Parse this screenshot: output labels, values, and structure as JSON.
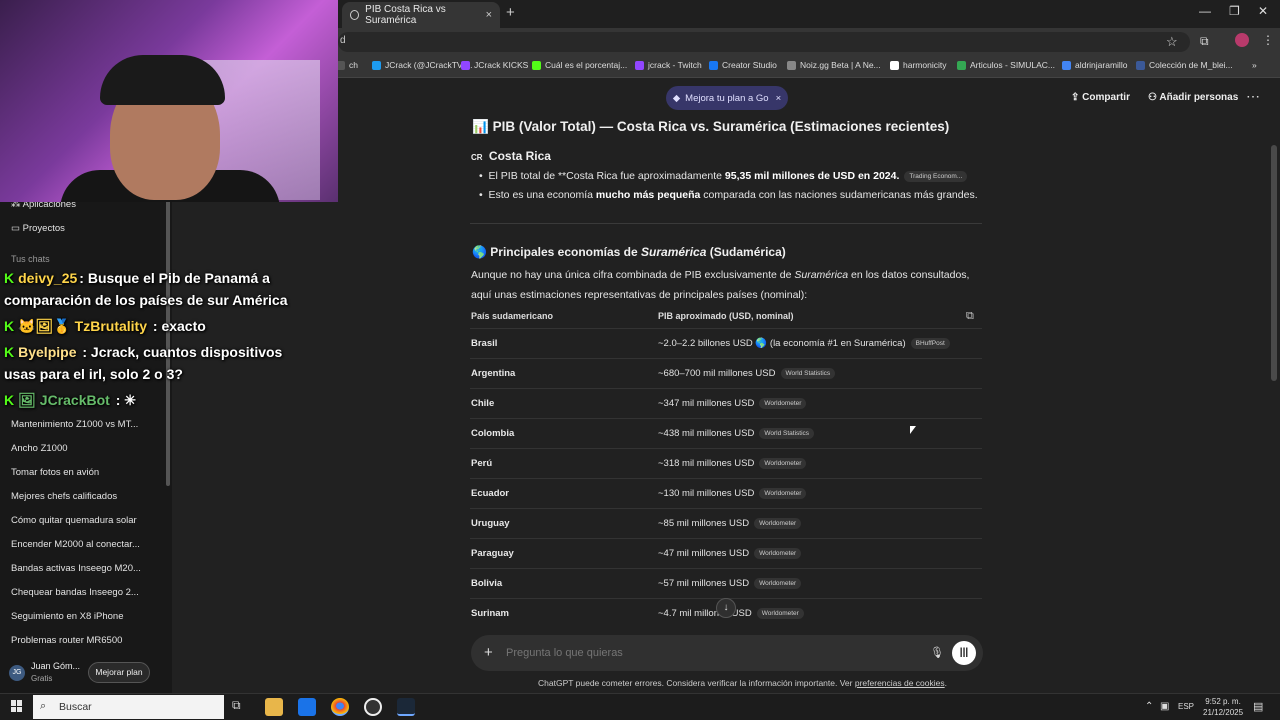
{
  "browser": {
    "tab_title": "PIB Costa Rica vs Suramérica",
    "tab_close": "×",
    "new_tab": "+",
    "window_controls": [
      "—",
      "❐",
      "✕"
    ],
    "omnibox_text": "d",
    "bookmarks": [
      {
        "label": "ch",
        "color": "#555"
      },
      {
        "label": "JCrack (@JCrackTV)...",
        "color": "#1d9bf0"
      },
      {
        "label": "JCrack KICKS",
        "color": "#9146ff"
      },
      {
        "label": "Cuál es el porcentaj...",
        "color": "#53fc18"
      },
      {
        "label": "jcrack - Twitch",
        "color": "#9146ff"
      },
      {
        "label": "Creator Studio",
        "color": "#1877f2"
      },
      {
        "label": "Noiz.gg Beta | A Ne...",
        "color": "#888"
      },
      {
        "label": "harmonicity",
        "color": "#ffffff"
      },
      {
        "label": "Articulos - SIMULAC...",
        "color": "#34a853"
      },
      {
        "label": "aldrinjaramillo",
        "color": "#4285f4"
      },
      {
        "label": "Colección de M_blei...",
        "color": "#3b5998"
      }
    ],
    "bookmarks_more": "»"
  },
  "sidebar": {
    "items_top": [
      {
        "icon": "apps-icon",
        "label": "Aplicaciones"
      },
      {
        "icon": "folder-icon",
        "label": "Proyectos"
      }
    ],
    "chats_label": "Tus chats",
    "chats": [
      "Mantenimiento Z1000 vs MT...",
      "Ancho Z1000",
      "Tomar fotos en avión",
      "Mejores chefs calificados",
      "Cómo quitar quemadura solar",
      "Encender M2000 al conectar...",
      "Bandas activas Inseego M20...",
      "Chequear bandas Inseego 2...",
      "Seguimiento en X8 iPhone",
      "Problemas router MR6500"
    ],
    "user_initials": "JG",
    "user_name": "Juan Góm...",
    "user_plan": "Gratis",
    "upgrade_label": "Mejorar plan"
  },
  "stream_chat": [
    {
      "user": "deivy_25",
      "message": ": Busque el Pib de Panamá a",
      "user_color": "#ffd54a"
    },
    {
      "user": "",
      "message": "comparación de los países de sur América",
      "user_color": "#ffffff"
    },
    {
      "user": "🐱🖼🥇 TzBrutality",
      "message": " : exacto",
      "user_color": "#ffd54a"
    },
    {
      "user": "Byelpipe",
      "message": " : Jcrack, cuantos dispositivos",
      "user_color": "#ffe08a"
    },
    {
      "user": "",
      "message": "usas para el irl, solo 2 o 3?",
      "user_color": "#ffffff"
    },
    {
      "user": "🖼 JCrackBot",
      "message": " : ✳",
      "user_color": "#66bb6a"
    }
  ],
  "header": {
    "promo": "Mejora tu plan a Go",
    "promo_close": "×",
    "share": "Compartir",
    "add_people": "Añadir personas",
    "more": "⋯"
  },
  "content": {
    "title": "PIB (Valor Total) — Costa Rica vs. Suramérica (Estimaciones recientes)",
    "title_icon": "📊",
    "cr_heading": "Costa Rica",
    "cr_flag": "CR",
    "cr_bullet1_pre": "El PIB total de **Costa Rica fue aproximadamente ",
    "cr_bullet1_bold": "95,35 mil millones de USD en 2024.",
    "cr_bullet1_chip": "Trading Econom...",
    "cr_bullet2_pre": "Esto es una economía ",
    "cr_bullet2_bold": "mucho más pequeña",
    "cr_bullet2_post": " comparada con las naciones sudamericanas más grandes.",
    "sa_heading_pre": "Principales economías de ",
    "sa_heading_em": "Suramérica",
    "sa_heading_post": " (Sudamérica)",
    "intro_line1_pre": "Aunque no hay una única cifra combinada de PIB exclusivamente de ",
    "intro_line1_em": "Suramérica",
    "intro_line1_post": " en los datos consultados,",
    "intro_line2": "aquí unas estimaciones representativas de principales países (nominal):",
    "table_headers": [
      "País sudamericano",
      "PIB aproximado (USD, nominal)"
    ],
    "table_rows": [
      {
        "country": "Brasil",
        "value": "~2.0–2.2 billones USD 🌎 (la economía #1 en Suramérica)",
        "source": "BHuffPost"
      },
      {
        "country": "Argentina",
        "value": "~680–700 mil millones USD",
        "source": "World Statistics"
      },
      {
        "country": "Chile",
        "value": "~347 mil millones USD",
        "source": "Worldometer"
      },
      {
        "country": "Colombia",
        "value": "~438 mil millones USD",
        "source": "World Statistics"
      },
      {
        "country": "Perú",
        "value": "~318 mil millones USD",
        "source": "Worldometer"
      },
      {
        "country": "Ecuador",
        "value": "~130 mil millones USD",
        "source": "Worldometer"
      },
      {
        "country": "Uruguay",
        "value": "~85 mil millones USD",
        "source": "Worldometer"
      },
      {
        "country": "Paraguay",
        "value": "~47 mil millones USD",
        "source": "Worldometer"
      },
      {
        "country": "Bolivia",
        "value": "~57 mil millones USD",
        "source": "Worldometer"
      },
      {
        "country": "Surinam",
        "value": "~4.7 mil millones USD",
        "source": "Worldometer"
      }
    ]
  },
  "composer": {
    "placeholder": "Pregunta lo que quieras",
    "disclaimer_pre": "ChatGPT puede cometer errores. Considera verificar la información importante. Ver ",
    "disclaimer_link": "preferencias de cookies",
    "disclaimer_post": "."
  },
  "taskbar": {
    "search_placeholder": "Buscar",
    "lang": "ESP",
    "time": "9:52 p. m.",
    "date": "21/12/2025"
  }
}
